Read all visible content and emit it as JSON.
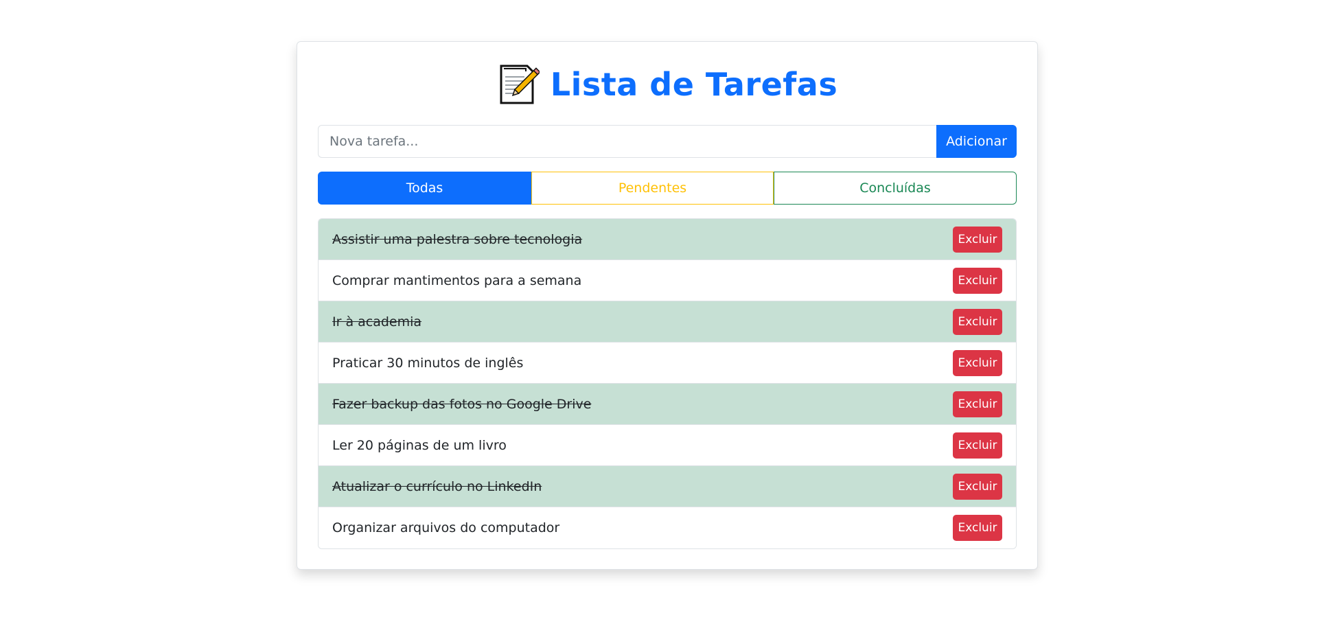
{
  "header": {
    "icon": "memo-icon",
    "title": "Lista de Tarefas"
  },
  "input": {
    "placeholder": "Nova tarefa...",
    "value": "",
    "add_label": "Adicionar"
  },
  "filters": {
    "all_label": "Todas",
    "pending_label": "Pendentes",
    "done_label": "Concluídas",
    "active": "Todas"
  },
  "tasks": [
    {
      "text": "Assistir uma palestra sobre tecnologia",
      "done": true,
      "delete_label": "Excluir"
    },
    {
      "text": "Comprar mantimentos para a semana",
      "done": false,
      "delete_label": "Excluir"
    },
    {
      "text": "Ir à academia",
      "done": true,
      "delete_label": "Excluir"
    },
    {
      "text": "Praticar 30 minutos de inglês",
      "done": false,
      "delete_label": "Excluir"
    },
    {
      "text": "Fazer backup das fotos no Google Drive",
      "done": true,
      "delete_label": "Excluir"
    },
    {
      "text": "Ler 20 páginas de um livro",
      "done": false,
      "delete_label": "Excluir"
    },
    {
      "text": "Atualizar o currículo no LinkedIn",
      "done": true,
      "delete_label": "Excluir"
    },
    {
      "text": "Organizar arquivos do computador",
      "done": false,
      "delete_label": "Excluir"
    }
  ],
  "colors": {
    "primary": "#0d6efd",
    "warning": "#ffc107",
    "success": "#198754",
    "danger": "#dc3545",
    "done_row": "#c6e0d4"
  }
}
